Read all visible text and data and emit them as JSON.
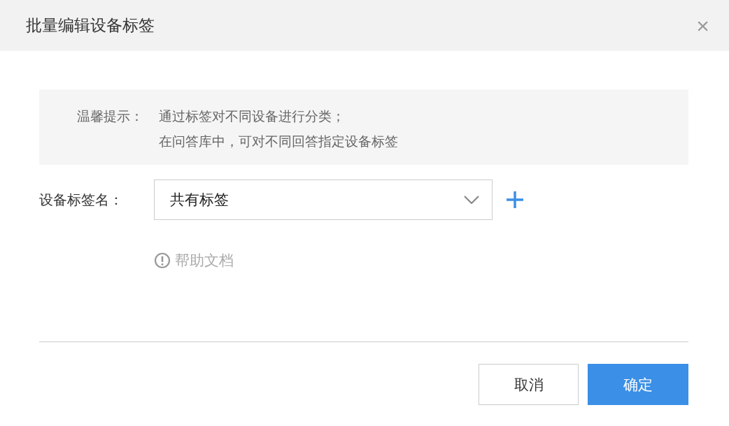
{
  "dialog": {
    "title": "批量编辑设备标签",
    "close": "×"
  },
  "tip": {
    "label": "温馨提示：",
    "lines": [
      "通过标签对不同设备进行分类；",
      "在问答库中，可对不同回答指定设备标签"
    ]
  },
  "form": {
    "label": "设备标签名：",
    "select_value": "共有标签"
  },
  "help_link": "帮助文档",
  "buttons": [
    {
      "label": "取消",
      "kind": "secondary"
    },
    {
      "label": "确定",
      "kind": "primary"
    }
  ]
}
